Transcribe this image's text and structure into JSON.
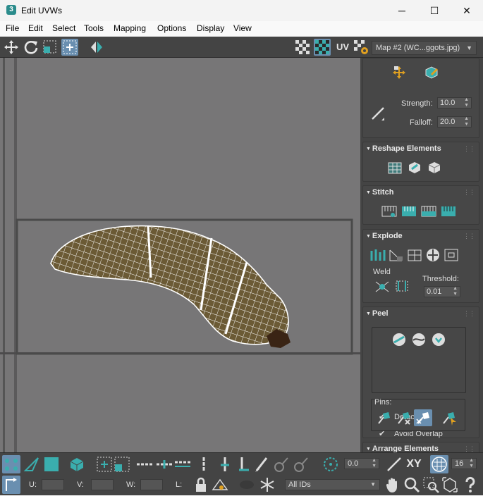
{
  "window": {
    "title": "Edit UVWs",
    "app_icon": "3",
    "minimize": "─",
    "maximize": "☐",
    "close": "✕"
  },
  "menu": [
    "File",
    "Edit",
    "Select",
    "Tools",
    "Mapping",
    "Options",
    "Display",
    "View"
  ],
  "toolbar": {
    "uv_label": "UV",
    "map_select": "Map #2 (WC...ggots.jpg)"
  },
  "panel": {
    "paint": {
      "strength_label": "Strength:",
      "strength_value": "10.0",
      "falloff_label": "Falloff:",
      "falloff_value": "20.0"
    },
    "reshape": {
      "title": "Reshape Elements"
    },
    "stitch": {
      "title": "Stitch"
    },
    "explode": {
      "title": "Explode",
      "weld_label": "Weld",
      "threshold_label": "Threshold:",
      "threshold_value": "0.01"
    },
    "peel": {
      "title": "Peel",
      "detach_label": "Detach",
      "avoid_overlap_label": "Avoid Overlap",
      "pins_label": "Pins:",
      "detach_checked": true,
      "avoid_overlap_checked": true
    },
    "arrange": {
      "title": "Arrange Elements"
    }
  },
  "bottom": {
    "angle_value": "0.0",
    "xy_label": "XY",
    "grid_value": "16",
    "u_label": "U:",
    "v_label": "V:",
    "w_label": "W:",
    "l_label": "L:",
    "ids_select": "All IDs"
  },
  "colors": {
    "accent": "#3aaeae",
    "panel_bg": "#444444",
    "viewport_bg": "#777677",
    "mesh": "#ffffff",
    "texture": "#6b5a35"
  }
}
